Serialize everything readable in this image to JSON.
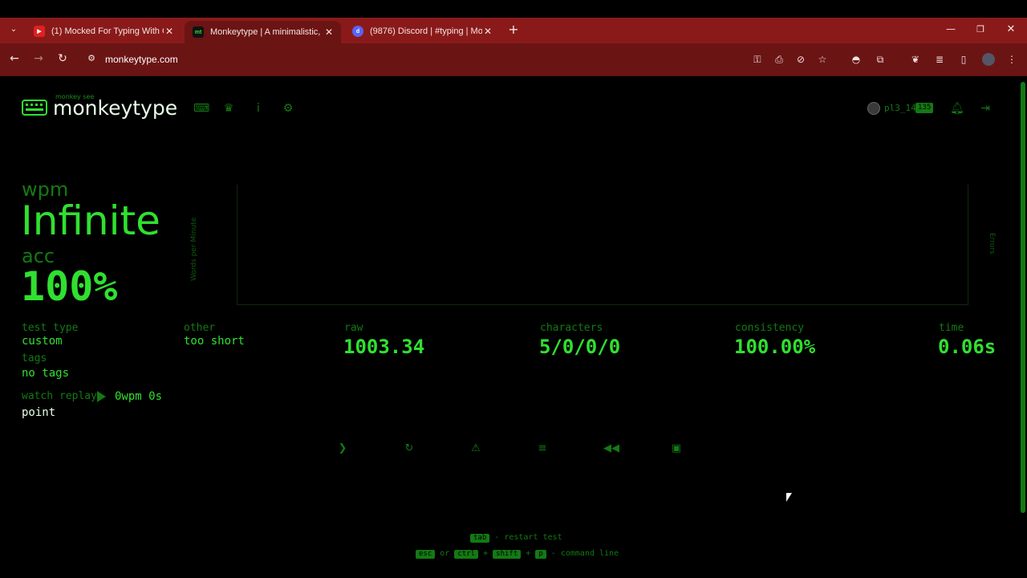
{
  "browser": {
    "tabs": [
      {
        "title": "(1) Mocked For Typing With One",
        "favicon": "youtube-icon",
        "active": false
      },
      {
        "title": "Monkeytype | A minimalistic, cu",
        "favicon": "monkeytype-icon",
        "active": true
      },
      {
        "title": "(9876) Discord | #typing | Monk",
        "favicon": "discord-icon",
        "active": false
      }
    ],
    "url": "monkeytype.com",
    "accent": "#8a1a1a"
  },
  "header": {
    "logo_top": "monkey see",
    "logo_text": "monkeytype",
    "user_name": "pl3_14",
    "user_level": "135"
  },
  "result": {
    "wpm_label": "wpm",
    "wpm_value": "Infinite",
    "acc_label": "acc",
    "acc_value": "100%",
    "chart_left_label": "Words per Minute",
    "chart_right_label": "Errors",
    "test_type_label": "test type",
    "test_type_value": "custom",
    "tags_label": "tags",
    "tags_value": "no tags",
    "other_label": "other",
    "other_value": "too short",
    "raw_label": "raw",
    "raw_value": "1003.34",
    "characters_label": "characters",
    "characters_value": "5/0/0/0",
    "consistency_label": "consistency",
    "consistency_value": "100.00%",
    "time_label": "time",
    "time_value": "0.06s",
    "replay_label": "watch replay",
    "replay_stats": "0wpm 0s",
    "replay_word": "point"
  },
  "footer": {
    "key_tab": "tab",
    "restart_text": "- restart test",
    "key_esc": "esc",
    "or_text": "or",
    "key_ctrl": "ctrl",
    "plus": "+",
    "key_shift": "shift",
    "key_p": "p",
    "command_text": "- command line"
  },
  "colors": {
    "main": "#30e030",
    "sub": "#137a13",
    "background": "#000000"
  }
}
